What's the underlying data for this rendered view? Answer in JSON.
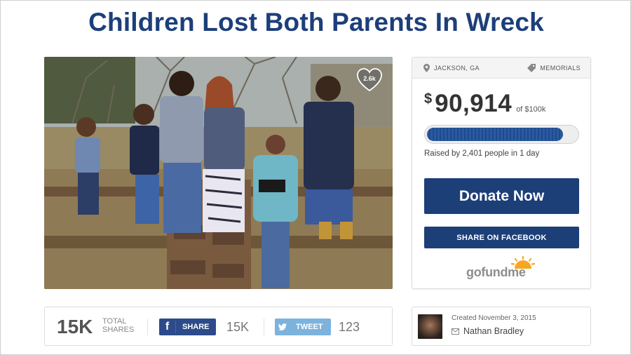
{
  "page": {
    "title": "Children Lost Both Parents In Wreck"
  },
  "photo": {
    "likes_badge": "2.6k"
  },
  "card": {
    "location": "JACKSON, GA",
    "category": "MEMORIALS",
    "currency_symbol": "$",
    "amount_raised": "90,914",
    "goal_text": "of $100k",
    "progress_fraction": 0.909,
    "raised_text": "Raised by 2,401 people in 1 day",
    "donate_label": "Donate Now",
    "share_facebook_label": "SHARE ON FACEBOOK",
    "logo": {
      "go": "go",
      "fund": "fund",
      "me": "me"
    }
  },
  "shares": {
    "total": "15K",
    "total_label_1": "TOTAL",
    "total_label_2": "SHARES",
    "facebook_icon": "f",
    "facebook_label": "SHARE",
    "facebook_count": "15K",
    "twitter_label": "TWEET",
    "twitter_count": "123"
  },
  "organizer": {
    "created": "Created November 3, 2015",
    "name": "Nathan Bradley"
  },
  "colors": {
    "brand_blue": "#1d3f78",
    "title_blue": "#1c3f7a",
    "facebook": "#2d4b8a",
    "twitter": "#7cb3dd",
    "gofundme_orange": "#f5a623"
  }
}
